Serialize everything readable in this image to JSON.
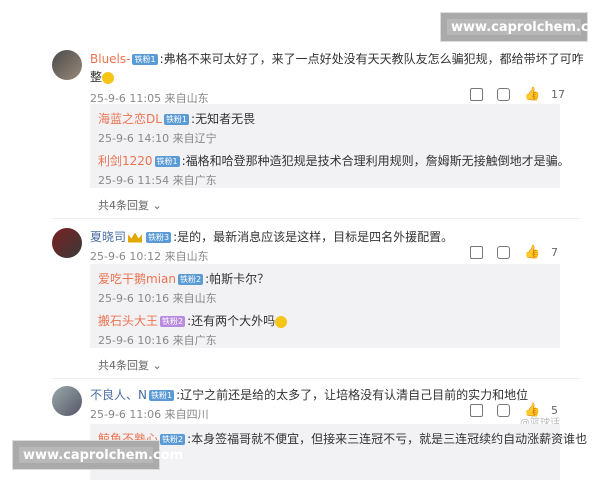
{
  "watermark": {
    "text": "www.caprolchem.com"
  },
  "comments": [
    {
      "user": "Bluels-",
      "badge": "铁粉1",
      "text": ":弗格不来可太好了，来了一点好处没有天天教队友怎么骗犯规，都给带坏了可咋",
      "text2": "整",
      "meta": "25-9-6 11:05 来自山东",
      "likes": "17",
      "replies": [
        {
          "user": "海蓝之恋DL",
          "badge": "铁粉1",
          "text": ":无知者无畏",
          "meta": "25-9-6 14:10 来自辽宁"
        },
        {
          "user": "利剑1220",
          "badge": "铁粉1",
          "text": ":福格和哈登那种造犯规是技术合理利用规则，詹姆斯无接触倒地才是骗。",
          "meta": "25-9-6 11:54 来自广东"
        }
      ],
      "more": "共4条回复"
    },
    {
      "user": "夏晓司",
      "badge": "铁粉3",
      "text": ":是的，最新消息应该是这样，目标是四名外援配置。",
      "meta": "25-9-6 10:12 来自山东",
      "likes": "7",
      "replies": [
        {
          "user": "爱吃干鹅mian",
          "badge": "铁粉2",
          "text": ":帕斯卡尔？",
          "meta": "25-9-6 10:16 来自山东"
        },
        {
          "user": "搬石头大王",
          "badge": "铁粉2",
          "text": ":还有两个大外吗",
          "meta": "25-9-6 10:16 来自广东"
        }
      ],
      "more": "共4条回复"
    },
    {
      "user": "不良人、N",
      "badge": "铁粉1",
      "text": ":辽宁之前还是给的太多了，让培格没有认清自己目前的实力和地位",
      "meta": "25-9-6 11:06 来自四川",
      "likes": "5",
      "replies": [
        {
          "user": "鲸鱼不熟心",
          "badge": "铁粉2",
          "text": ":本身签福哥就不便宜，但接来三连冠不亏，就是三连冠续约自动涨薪资谁也",
          "meta": ""
        }
      ]
    }
  ],
  "source_mark": "@篮球话"
}
